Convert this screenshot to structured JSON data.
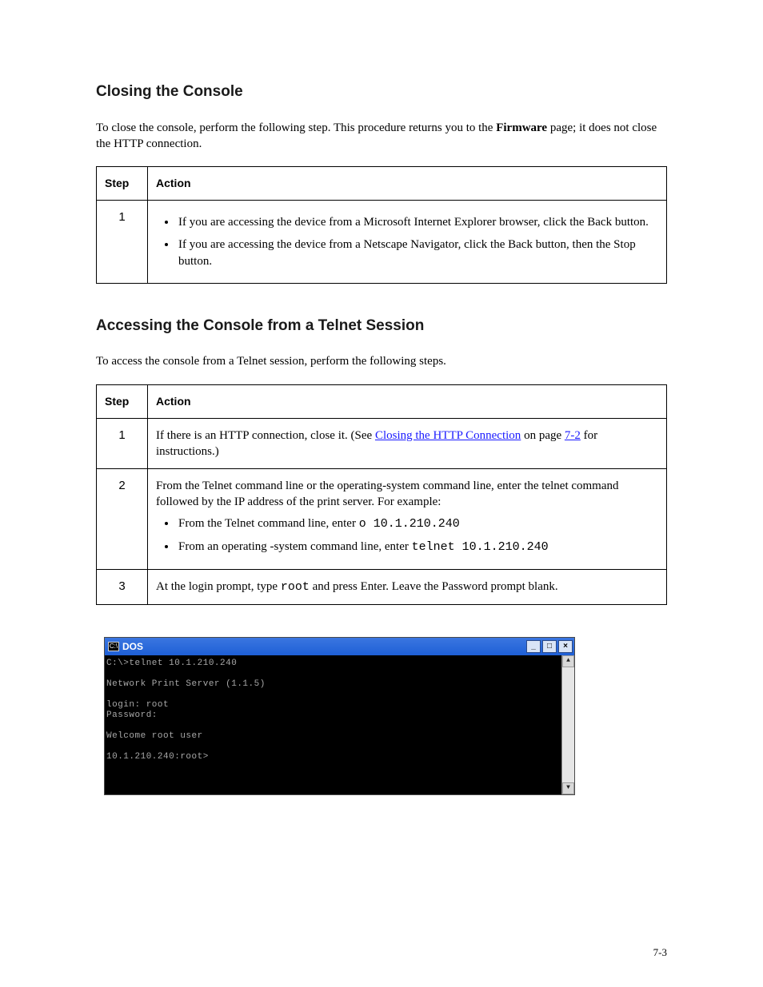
{
  "section1": {
    "title": "Closing the Console",
    "intro_before_strong": "To close the console, perform the following step. This procedure returns you to the ",
    "intro_strong": "Firmware",
    "intro_after_strong": " page; it does not close the HTTP connection.",
    "table": {
      "h_step": "Step",
      "h_action": "Action",
      "rows": [
        {
          "step": "1",
          "bullets": [
            "If you are accessing the device from a Microsoft Internet Explorer browser, click the Back button.",
            "If you are accessing the device from a Netscape Navigator, click the Back button, then the Stop button."
          ]
        }
      ]
    }
  },
  "section2": {
    "title": "Accessing the Console from a Telnet Session",
    "intro": "To access the console from a Telnet session, perform the following steps.",
    "table": {
      "h_step": "Step",
      "h_action": "Action",
      "rows": [
        {
          "step": "1",
          "plain_before_link1": "If there is an HTTP connection, close it. (See ",
          "link1_text": "Closing the HTTP Connection",
          "plain_mid": " on page ",
          "link2_text": "7-2",
          "plain_after": " for instructions.)"
        },
        {
          "step": "2",
          "plain_para": "From the Telnet command line or the operating-system command line, enter the telnet command followed by the IP address of the print server. For example:",
          "bullets": [
            {
              "before_kbd": "From the Telnet command line, enter ",
              "kbd": "o 10.1.210.240"
            },
            {
              "before_kbd": "From an operating -system command line, enter ",
              "kbd": "telnet 10.1.210.240"
            }
          ]
        },
        {
          "step": "3",
          "plain_before_kbd": "At the login prompt, type ",
          "kbd": "root",
          "plain_after_kbd": " and press Enter. Leave the Password prompt blank."
        }
      ]
    }
  },
  "dos": {
    "title": "DOS",
    "minimize": "_",
    "maximize": "□",
    "close": "×",
    "scroll_up": "▲",
    "scroll_down": "▼",
    "lines": "C:\\>telnet 10.1.210.240\n\nNetwork Print Server (1.1.5)\n\nlogin: root\nPassword:\n\nWelcome root user\n\n10.1.210.240:root>"
  },
  "pagenum": "7-3"
}
